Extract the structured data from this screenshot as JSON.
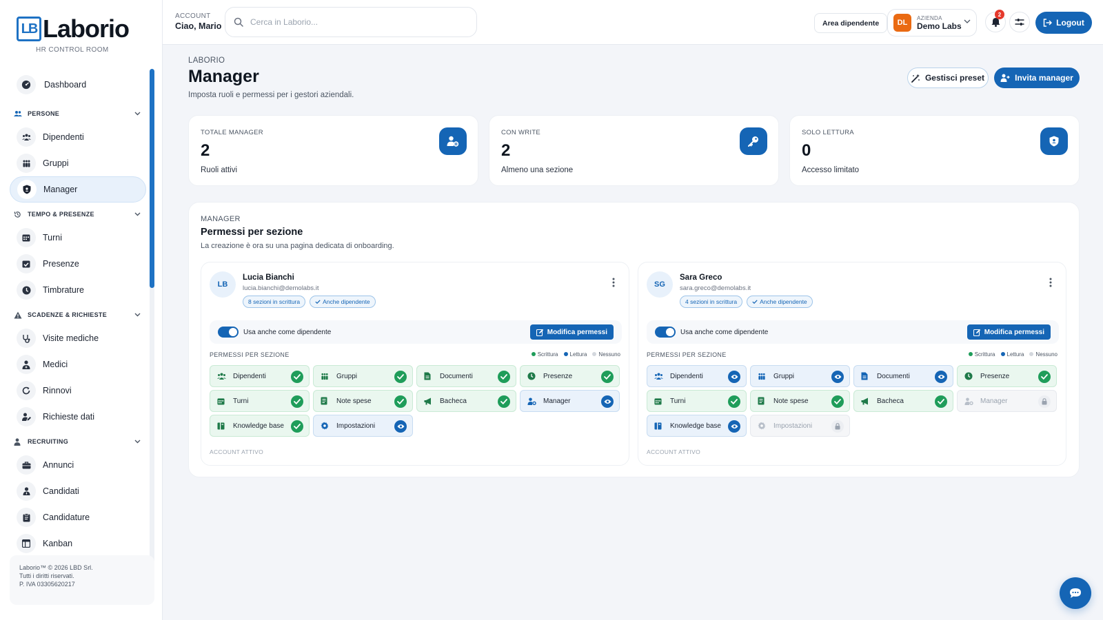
{
  "brand": {
    "logo_mark": "LB",
    "name": "Laborio",
    "subtitle": "HR CONTROL ROOM"
  },
  "sidebar": {
    "dashboard": "Dashboard",
    "sections": [
      {
        "title": "PERSONE",
        "icon": "people-icon",
        "items": [
          "Dipendenti",
          "Gruppi",
          "Manager"
        ]
      },
      {
        "title": "TEMPO & PRESENZE",
        "icon": "history-icon",
        "items": [
          "Turni",
          "Presenze",
          "Timbrature"
        ]
      },
      {
        "title": "SCADENZE & RICHIESTE",
        "icon": "warning-icon",
        "items": [
          "Visite mediche",
          "Medici",
          "Rinnovi",
          "Richieste dati"
        ]
      },
      {
        "title": "RECRUITING",
        "icon": "person-icon",
        "items": [
          "Annunci",
          "Candidati",
          "Candidature",
          "Kanban"
        ]
      }
    ],
    "active": "Manager",
    "footer": {
      "line1": "Laborio™ © 2026 LBD Srl.",
      "line2": "Tutti i diritti riservati.",
      "line3": "P. IVA 03305620217"
    }
  },
  "topbar": {
    "account_label": "ACCOUNT",
    "account_name": "Ciao, Mario",
    "search_placeholder": "Cerca in Laborio...",
    "area_button": "Area dipendente",
    "company_label": "AZIENDA",
    "company_name": "Demo Labs",
    "company_badge": "DL",
    "notifications_count": "2",
    "logout": "Logout"
  },
  "page": {
    "breadcrumb": "LABORIO",
    "title": "Manager",
    "subtitle": "Imposta ruoli e permessi per i gestori aziendali.",
    "btn_presets": "Gestisci preset",
    "btn_invite": "Invita manager"
  },
  "stats": [
    {
      "label": "TOTALE MANAGER",
      "value": "2",
      "desc": "Ruoli attivi",
      "icon": "user-gear-icon"
    },
    {
      "label": "CON WRITE",
      "value": "2",
      "desc": "Almeno una sezione",
      "icon": "key-icon"
    },
    {
      "label": "SOLO LETTURA",
      "value": "0",
      "desc": "Accesso limitato",
      "icon": "shield-icon"
    }
  ],
  "panel": {
    "kicker": "MANAGER",
    "title": "Permessi per sezione",
    "subtitle": "La creazione è ora su una pagina dedicata di onboarding."
  },
  "managers": [
    {
      "initials": "LB",
      "name": "Lucia Bianchi",
      "email": "lucia.bianchi@demolabs.it",
      "chip_sections": "8 sezioni in scrittura",
      "chip_employee": "Anche dipendente",
      "toggle_label": "Usa anche come dipendente",
      "edit_button": "Modifica permessi",
      "perm_header": "PERMESSI PER SEZIONE",
      "legend": [
        "Scrittura",
        "Lettura",
        "Nessuno"
      ],
      "status": "ACCOUNT ATTIVO",
      "permissions": [
        {
          "label": "Dipendenti",
          "level": "write",
          "icon": "people-icon"
        },
        {
          "label": "Gruppi",
          "level": "write",
          "icon": "group-icon"
        },
        {
          "label": "Documenti",
          "level": "write",
          "icon": "document-icon"
        },
        {
          "label": "Presenze",
          "level": "write",
          "icon": "clock-icon"
        },
        {
          "label": "Turni",
          "level": "write",
          "icon": "calendar-icon"
        },
        {
          "label": "Note spese",
          "level": "write",
          "icon": "receipt-icon"
        },
        {
          "label": "Bacheca",
          "level": "write",
          "icon": "megaphone-icon"
        },
        {
          "label": "Manager",
          "level": "read",
          "icon": "user-gear-icon"
        },
        {
          "label": "Knowledge base",
          "level": "write",
          "icon": "book-icon"
        },
        {
          "label": "Impostazioni",
          "level": "read",
          "icon": "gear-icon"
        }
      ]
    },
    {
      "initials": "SG",
      "name": "Sara Greco",
      "email": "sara.greco@demolabs.it",
      "chip_sections": "4 sezioni in scrittura",
      "chip_employee": "Anche dipendente",
      "toggle_label": "Usa anche come dipendente",
      "edit_button": "Modifica permessi",
      "perm_header": "PERMESSI PER SEZIONE",
      "legend": [
        "Scrittura",
        "Lettura",
        "Nessuno"
      ],
      "status": "ACCOUNT ATTIVO",
      "permissions": [
        {
          "label": "Dipendenti",
          "level": "read",
          "icon": "people-icon"
        },
        {
          "label": "Gruppi",
          "level": "read",
          "icon": "group-icon"
        },
        {
          "label": "Documenti",
          "level": "read",
          "icon": "document-icon"
        },
        {
          "label": "Presenze",
          "level": "write",
          "icon": "clock-icon"
        },
        {
          "label": "Turni",
          "level": "write",
          "icon": "calendar-icon"
        },
        {
          "label": "Note spese",
          "level": "write",
          "icon": "receipt-icon"
        },
        {
          "label": "Bacheca",
          "level": "write",
          "icon": "megaphone-icon"
        },
        {
          "label": "Manager",
          "level": "none",
          "icon": "user-gear-icon"
        },
        {
          "label": "Knowledge base",
          "level": "read",
          "icon": "book-icon"
        },
        {
          "label": "Impostazioni",
          "level": "none",
          "icon": "gear-icon"
        }
      ]
    }
  ],
  "colors": {
    "primary": "#1565b5",
    "write": "#1f9d5a",
    "read": "#1565b5",
    "none": "#c4c9d1",
    "company_badge": "#ea6a12",
    "notification": "#e5392c"
  }
}
